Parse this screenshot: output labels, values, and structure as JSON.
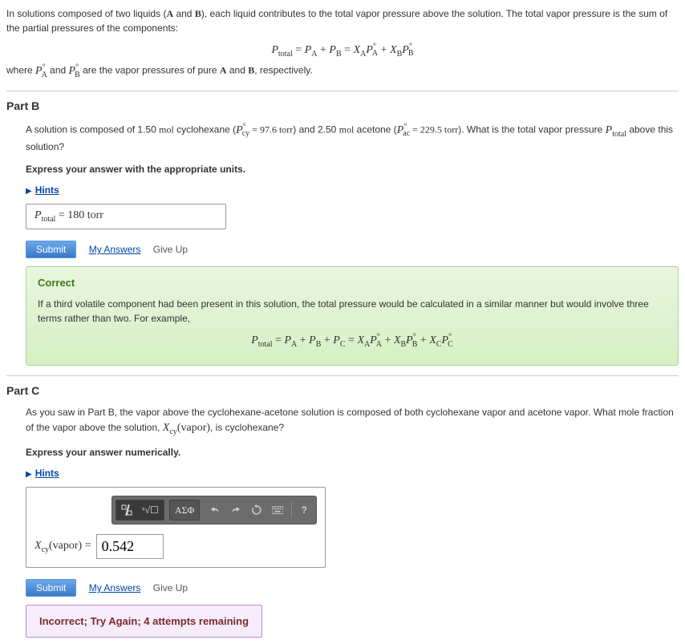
{
  "intro": {
    "line1a": "In solutions composed of two liquids (",
    "line1b": " and ",
    "line1c": "), each liquid contributes to the total vapor pressure above the solution. The total vapor pressure is the sum of the partial pressures of the components:",
    "symA": "A",
    "symB": "B",
    "where_a": "where ",
    "where_b": " and ",
    "where_c": " are the vapor pressures of pure ",
    "where_d": " and ",
    "where_e": ", respectively.",
    "eq_main": "P_total = P_A + P_B = X_A P_A° + X_B P_B°"
  },
  "partB": {
    "title": "Part B",
    "q1": "A solution is composed of 1.50 ",
    "mol": "mol",
    "q2": " cyclohexane (",
    "pcy_val": " = 97.6 torr",
    "q3": ") and 2.50 ",
    "q4": " acetone (",
    "pac_val": " = 229.5 torr",
    "q5": "). What is the total vapor pressure ",
    "q6": " above this solution?",
    "instruction": "Express your answer with the appropriate units.",
    "hints": "Hints",
    "label": "P",
    "label_sub": "total",
    "equals": " = ",
    "value": "180 torr",
    "submit": "Submit",
    "my_answers": "My Answers",
    "give_up": "Give Up",
    "correct_title": "Correct",
    "correct_text": "If a third volatile component had been present in this solution, the total pressure would be calculated in a similar manner but would involve three terms rather than two. For example,"
  },
  "partC": {
    "title": "Part C",
    "q1": "As you saw in Part B, the vapor above the cyclohexane-acetone solution is composed of both cyclohexane vapor and acetone vapor. What mole fraction of the vapor above the solution, ",
    "xcy": "X",
    "xcy_sub": "cy",
    "vapor": "(vapor)",
    "q2": ", is cyclohexane?",
    "instruction": "Express your answer numerically.",
    "hints": "Hints",
    "toolbar": {
      "greek": "ΑΣΦ"
    },
    "label_a": "X",
    "label_sub": "cy",
    "label_b": "(vapor) = ",
    "value": "0.542",
    "submit": "Submit",
    "my_answers": "My Answers",
    "give_up": "Give Up",
    "incorrect": "Incorrect; Try Again; 4 attempts remaining"
  }
}
